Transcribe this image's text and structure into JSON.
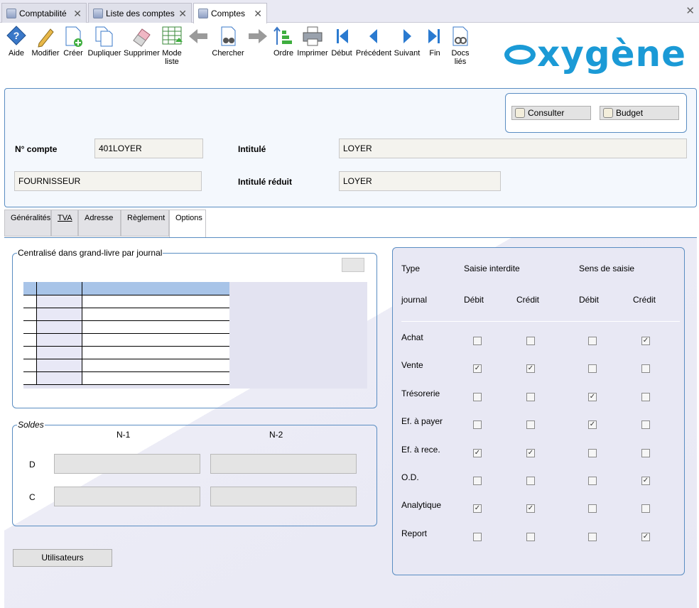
{
  "window_tabs": [
    {
      "label": "Comptabilité"
    },
    {
      "label": "Liste des comptes"
    },
    {
      "label": "Comptes"
    }
  ],
  "toolbar": {
    "aide": "Aide",
    "modifier": "Modifier",
    "creer": "Créer",
    "dupliquer": "Dupliquer",
    "supprimer": "Supprimer",
    "mode_liste_1": "Mode",
    "mode_liste_2": "liste",
    "chercher": "Chercher",
    "ordre": "Ordre",
    "imprimer": "Imprimer",
    "debut": "Début",
    "precedent": "Précédent",
    "suivant": "Suivant",
    "fin": "Fin",
    "docs_lies_1": "Docs",
    "docs_lies_2": "liés"
  },
  "logo": {
    "text": "xygène"
  },
  "header": {
    "consulter": "Consulter",
    "budget": "Budget",
    "num_compte_label": "N° compte",
    "num_compte_value": "401LOYER",
    "intitule_label": "Intitulé",
    "intitule_value": "LOYER",
    "type_value": "FOURNISSEUR",
    "intitule_reduit_label": "Intitulé réduit",
    "intitule_reduit_value": "LOYER"
  },
  "tabs": {
    "generalites": "Généralités",
    "tva": "TVA",
    "adresse": "Adresse",
    "reglement": "Règlement",
    "options": "Options"
  },
  "centralise": {
    "legend": "Centralisé dans grand-livre par journal"
  },
  "soldes": {
    "legend": "Soldes",
    "n1": "N-1",
    "n2": "N-2",
    "d": "D",
    "c": "C"
  },
  "utilisateurs": "Utilisateurs",
  "options": {
    "type": "Type",
    "journal": "journal",
    "saisie_interdite": "Saisie interdite",
    "sens_de_saisie": "Sens de saisie",
    "debit": "Débit",
    "credit": "Crédit",
    "rows": [
      {
        "label": "Achat",
        "si_debit": false,
        "si_credit": false,
        "ss_debit": false,
        "ss_credit": true
      },
      {
        "label": "Vente",
        "si_debit": true,
        "si_credit": true,
        "ss_debit": false,
        "ss_credit": false
      },
      {
        "label": "Trésorerie",
        "si_debit": false,
        "si_credit": false,
        "ss_debit": true,
        "ss_credit": false
      },
      {
        "label": "Ef. à payer",
        "si_debit": false,
        "si_credit": false,
        "ss_debit": true,
        "ss_credit": false
      },
      {
        "label": "Ef.  à rece.",
        "si_debit": true,
        "si_credit": true,
        "ss_debit": false,
        "ss_credit": false
      },
      {
        "label": "O.D.",
        "si_debit": false,
        "si_credit": false,
        "ss_debit": false,
        "ss_credit": true
      },
      {
        "label": "Analytique",
        "si_debit": true,
        "si_credit": true,
        "ss_debit": false,
        "ss_credit": false
      },
      {
        "label": "Report",
        "si_debit": false,
        "si_credit": false,
        "ss_debit": false,
        "ss_credit": true
      }
    ]
  }
}
